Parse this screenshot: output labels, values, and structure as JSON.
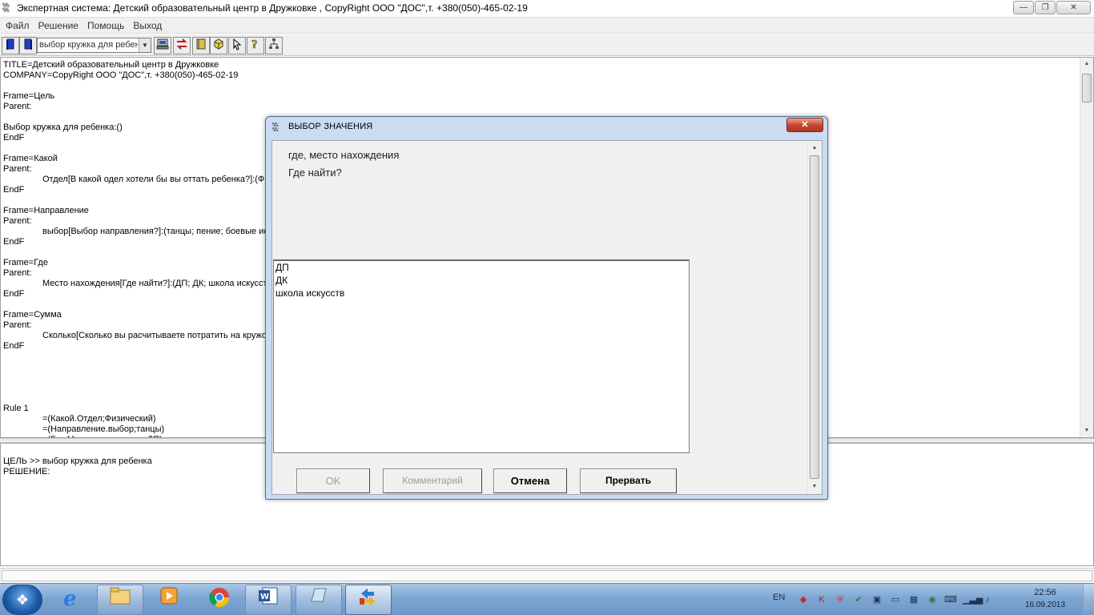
{
  "window": {
    "title": "Экспертная система: Детский  образовательный центр в  Дружковке , CopyRight ООО \"ДОС\",т. +380(050)-465-02-19",
    "minimize": "—",
    "maximize": "❐",
    "close": "✕"
  },
  "menu": [
    "Файл",
    "Решение",
    "Помощь",
    "Выход"
  ],
  "toolbar": {
    "combo_value": "выбор кружка  для  ребенка:()"
  },
  "editor": {
    "lines": [
      "TITLE=Детский  образовательный центр в  Дружковке",
      "COMPANY=CopyRight ООО \"ДОС\",т. +380(050)-465-02-19",
      "",
      "Frame=Цель",
      "Parent:",
      "",
      "Выбор кружка  для  ребенка:()",
      "EndF",
      "",
      "Frame=Какой",
      "Parent:",
      "\tОтдел[В какой одел хотели бы  вы  оттать  ребенка?]:(Физический;",
      "EndF",
      "",
      "Frame=Направление",
      "Parent:",
      "\tвыбор[Выбор  направления?]:(танцы; пение; боевые искусства)",
      "EndF",
      "",
      "Frame=Где",
      "Parent:",
      "\tМесто нахождения[Где найти?]:(ДП; ДК; школа искусств)",
      "EndF",
      "",
      "Frame=Сумма",
      "Parent:",
      "\tСколько[Сколько вы расчитываете потратить на кружок?]",
      "EndF",
      "",
      "",
      "",
      "",
      "",
      "Rule 1",
      "\t=(Какой.Отдел;Физический)",
      "\t=(Направление.выбор;танцы)",
      "\t=(Где.Место нахождения;ДП)"
    ]
  },
  "output": {
    "lines": [
      "",
      "ЦЕЛЬ >> выбор кружка  для  ребенка",
      "РЕШЕНИЕ:"
    ]
  },
  "dialog": {
    "title": "ВЫБОР ЗНАЧЕНИЯ",
    "close": "✕",
    "attribute": "где, место нахождения",
    "question": "Где найти?",
    "options": [
      "ДП",
      "ДК",
      "школа искусств"
    ],
    "buttons": {
      "ok": "OK",
      "comment": "Комментарий",
      "cancel": "Отмена",
      "abort": "Прервать"
    }
  },
  "taskbar": {
    "lang": "EN",
    "time": "22:56",
    "date": "16.09.2013"
  }
}
